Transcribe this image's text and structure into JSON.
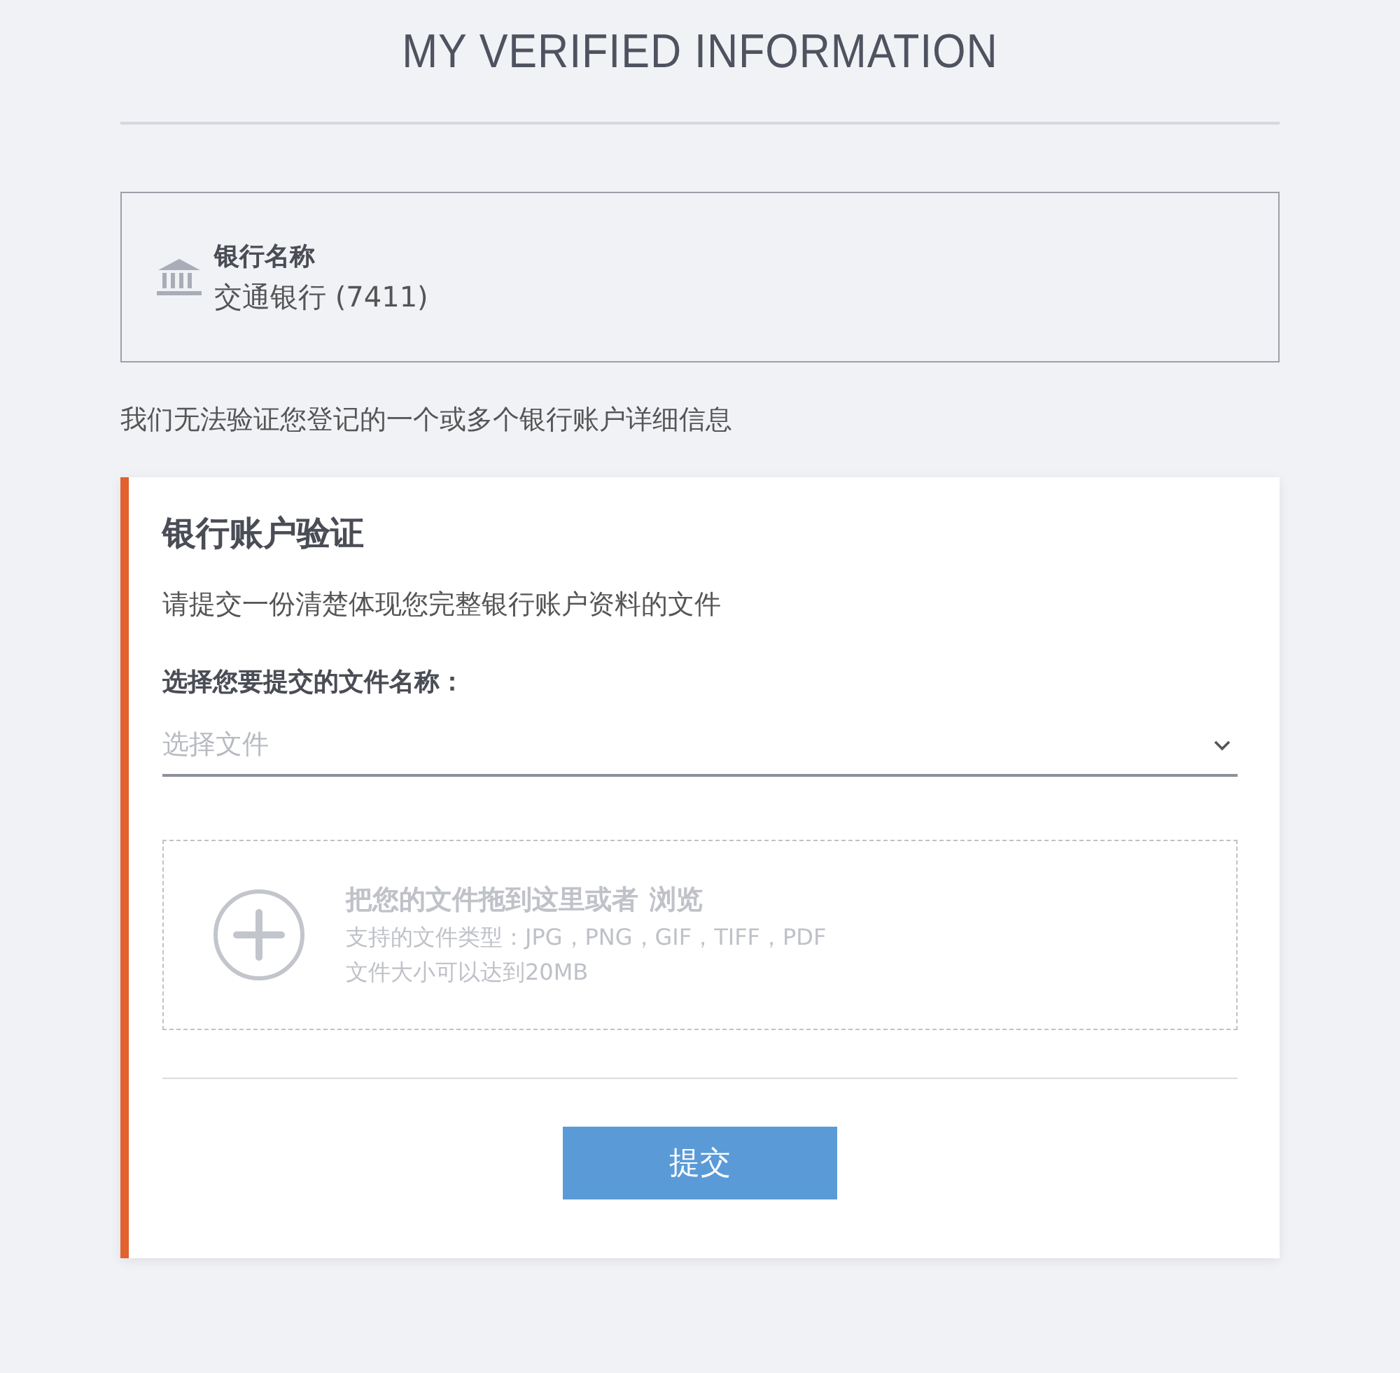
{
  "page_title": "MY VERIFIED INFORMATION",
  "bank": {
    "label": "银行名称",
    "value": "交通银行 (7411)"
  },
  "notice": "我们无法验证您登记的一个或多个银行账户详细信息",
  "card": {
    "title": "银行账户验证",
    "description": "请提交一份清楚体现您完整银行账户资料的文件",
    "select_label": "选择您要提交的文件名称：",
    "select": {
      "placeholder": "选择文件"
    },
    "dropzone": {
      "title": "把您的文件拖到这里或者",
      "browse_link": "浏览",
      "types": "支持的文件类型：JPG，PNG，GIF，TIFF，PDF",
      "size": "文件大小可以达到20MB"
    },
    "submit": "提交"
  }
}
